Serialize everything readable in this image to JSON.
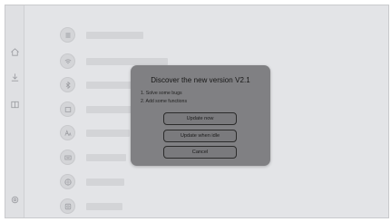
{
  "sidebar": {
    "items": [
      {
        "icon": "home-icon"
      },
      {
        "icon": "download-icon"
      },
      {
        "icon": "book-icon"
      },
      {
        "icon": "settings-icon"
      }
    ]
  },
  "settings_list": {
    "items": [
      {
        "icon": "menu-icon"
      },
      {
        "icon": "wifi-icon"
      },
      {
        "icon": "bluetooth-icon"
      },
      {
        "icon": "display-icon"
      },
      {
        "icon": "font-size-icon"
      },
      {
        "icon": "keyboard-icon"
      },
      {
        "icon": "globe-icon"
      },
      {
        "icon": "storage-icon"
      }
    ]
  },
  "dialog": {
    "title": "Discover the new version V2.1",
    "notes": [
      "1. Solve some bugs",
      "2. Add some functions"
    ],
    "buttons": {
      "update_now": "Update  now",
      "update_idle": "Update when idle",
      "cancel": "Cancel"
    }
  },
  "colors": {
    "background": "#e3e4e7",
    "placeholder": "#d3d4d7",
    "dialog_bg": "#808083",
    "button_border": "#2b2b2b"
  }
}
